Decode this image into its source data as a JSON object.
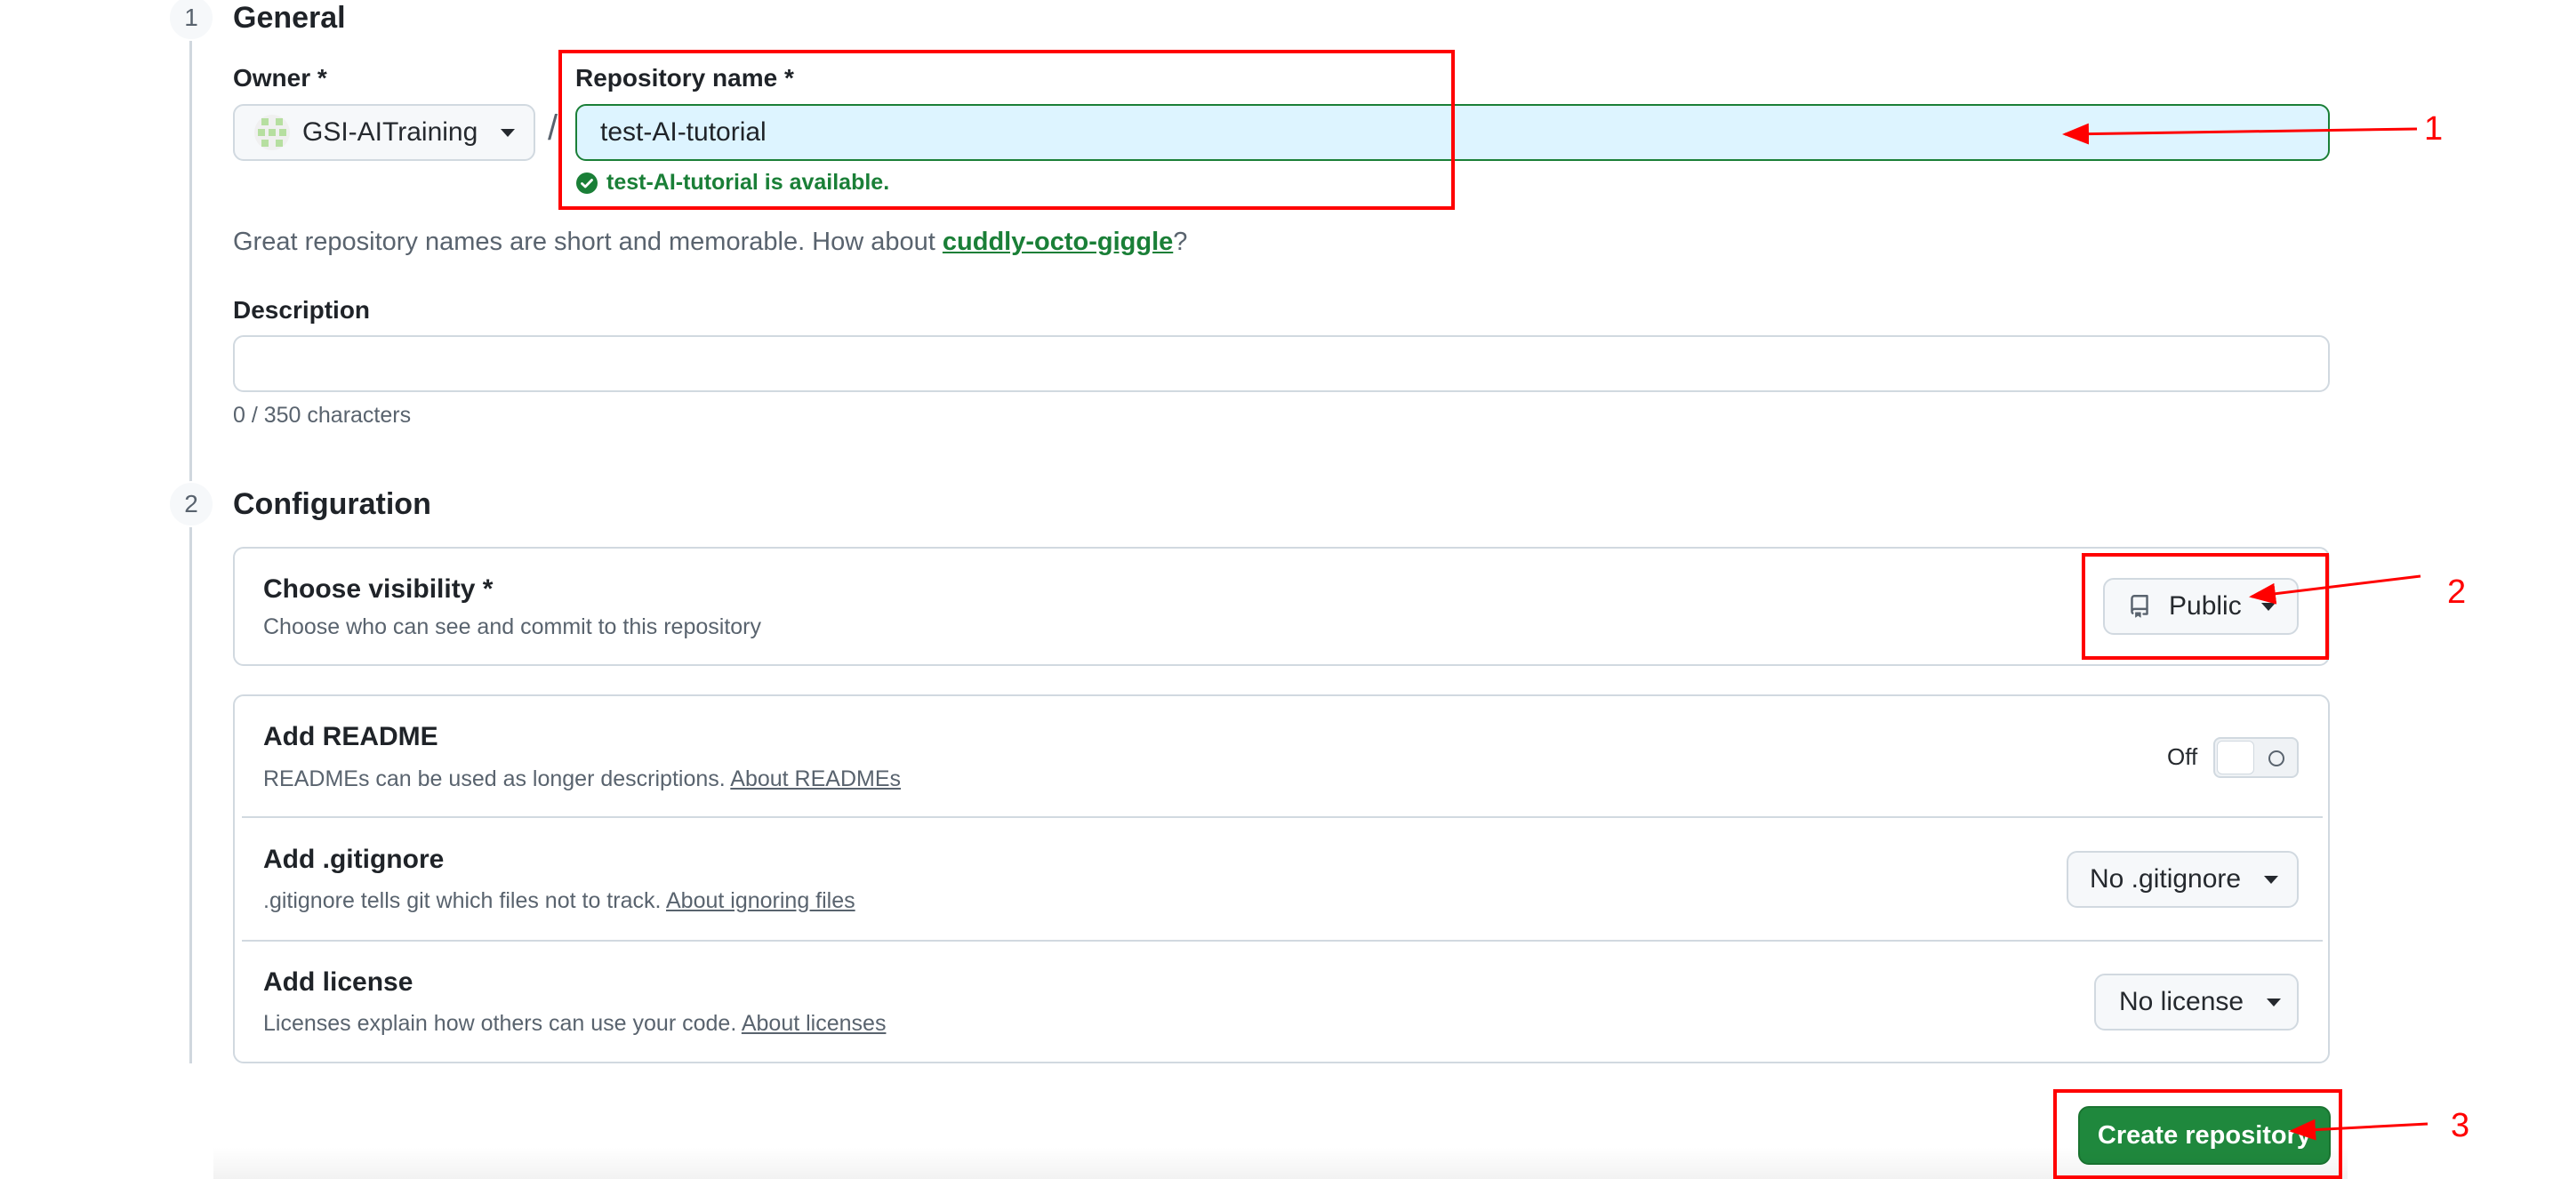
{
  "steps": {
    "general": {
      "number": "1",
      "title": "General"
    },
    "configuration": {
      "number": "2",
      "title": "Configuration"
    }
  },
  "owner": {
    "label": "Owner *",
    "value": "GSI-AITraining",
    "separator": "/"
  },
  "repo_name": {
    "label": "Repository name *",
    "value": "test-AI-tutorial",
    "availability": "test-AI-tutorial is available."
  },
  "suggestion": {
    "text": "Great repository names are short and memorable. How about ",
    "link": "cuddly-octo-giggle",
    "suffix": "?"
  },
  "description": {
    "label": "Description",
    "value": "",
    "counter": "0 / 350 characters"
  },
  "visibility": {
    "title": "Choose visibility *",
    "desc": "Choose who can see and commit to this repository",
    "selected": "Public"
  },
  "readme": {
    "title": "Add README",
    "desc": "READMEs can be used as longer descriptions. ",
    "link": "About READMEs",
    "toggle_label": "Off",
    "toggle_state": "off"
  },
  "gitignore": {
    "title": "Add .gitignore",
    "desc": ".gitignore tells git which files not to track. ",
    "link": "About ignoring files",
    "selected": "No .gitignore"
  },
  "license": {
    "title": "Add license",
    "desc": "Licenses explain how others can use your code. ",
    "link": "About licenses",
    "selected": "No license"
  },
  "create_button": {
    "label": "Create repository"
  },
  "annotations": [
    "1",
    "2",
    "3"
  ],
  "colors": {
    "success": "#1a7f37",
    "primary_button": "#1f883d",
    "annotation": "#ff0000",
    "input_focus_bg": "#ddf4ff"
  },
  "icons": {
    "check": "check-circle-fill-icon",
    "repo": "repo-icon",
    "caret": "triangle-down-icon",
    "avatar": "identicon"
  }
}
